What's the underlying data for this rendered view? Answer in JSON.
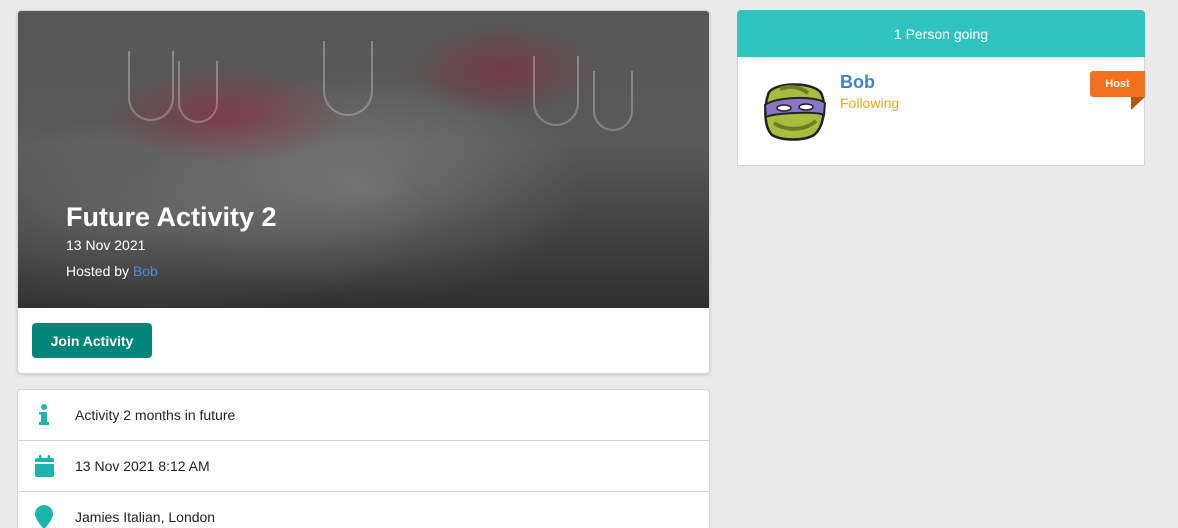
{
  "activity": {
    "title": "Future Activity 2",
    "date": "13 Nov 2021",
    "hosted_by_prefix": "Hosted by ",
    "host_name": "Bob",
    "join_label": "Join Activity"
  },
  "details": [
    {
      "icon": "info-icon",
      "text": "Activity 2 months in future"
    },
    {
      "icon": "calendar-icon",
      "text": "13 Nov 2021 8:12 AM"
    },
    {
      "icon": "map-marker-icon",
      "text": "Jamies Italian, London"
    }
  ],
  "attendees": {
    "header": "1 Person going",
    "list": [
      {
        "name": "Bob",
        "status": "Following",
        "badge": "Host"
      }
    ]
  },
  "colors": {
    "teal_button": "#00857a",
    "teal_header": "#2fc2bf",
    "link_blue": "#4183c4",
    "following_orange": "#f2a516",
    "host_orange": "#f2711c"
  }
}
